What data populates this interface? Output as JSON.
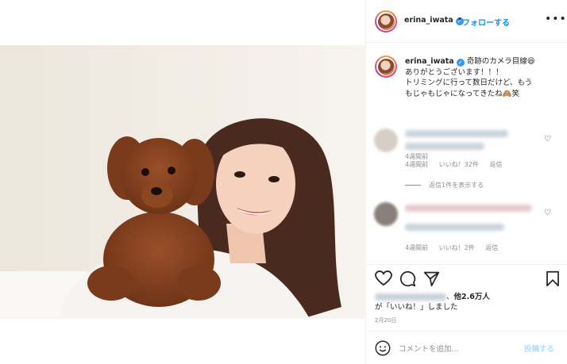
{
  "post": {
    "username": "erina_iwata",
    "follow_label": "フォローする",
    "more_label": "•••",
    "caption_lines": [
      "奇跡のカメラ目線😆",
      "ありがとうございます！！！",
      "トリミングに行って数日だけど、もう",
      "もじゃもじゃになってきたね🙈笑"
    ],
    "caption_time": "4週間前"
  },
  "comments": [
    {
      "time": "4週間前",
      "likes": "いいね！32件",
      "reply": "返信"
    },
    {
      "time": "4週間前",
      "likes": "いいね！2件",
      "reply": "返信"
    }
  ],
  "replies_label": "返信1件を表示する",
  "likes": {
    "count": "他2.6万人",
    "suffix": "が「いいね！」しました"
  },
  "date": "2月20日",
  "add_comment": {
    "placeholder": "コメントを追加...",
    "post_label": "投稿する"
  },
  "icons": [
    "verified-badge-icon",
    "heart-icon",
    "comment-icon",
    "share-icon",
    "bookmark-icon",
    "emoji-icon"
  ],
  "colors": {
    "accent": "#0095f6",
    "verified": "#3897f0",
    "muted": "#8e8e8e"
  }
}
